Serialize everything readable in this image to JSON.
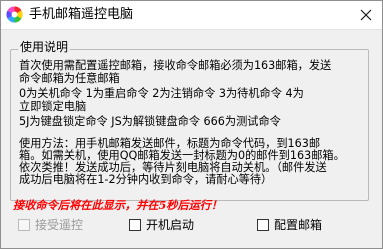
{
  "window": {
    "title": "手机邮箱遥控电脑"
  },
  "instructions": {
    "group_title": "使用说明",
    "lines": [
      "首次使用需配置遥控邮箱，接收命令邮箱必须为163邮箱，发送",
      "命令邮箱为任意邮箱",
      "0为关机命令   1为重启命令   2为注销命令   3为待机命令   4为",
      "立即锁定电脑",
      "5J为键盘锁定命令   JS为解锁键盘命令   666为测试命令",
      "",
      "使用方法：用手机邮箱发送邮件，标题为命令代码，到163邮",
      "箱。如需关机，使用QQ邮箱发送一封标题为0的邮件到163邮箱。",
      "依次类推！发送成功后，等待片刻电脑将自动关机。（邮件发送",
      "成功后电脑将在1-2分钟内收到命令，请耐心等待）"
    ]
  },
  "warning_text": "接收命令后将在此显示，并在5秒后运行！",
  "options": {
    "accept_remote": {
      "label": "接受遥控",
      "checked": false,
      "disabled": true
    },
    "startup": {
      "label": "开机启动",
      "checked": false,
      "disabled": false
    },
    "configure_mailbox": {
      "label": "配置邮箱",
      "checked": false,
      "disabled": false
    }
  },
  "colors": {
    "warning": "#ff0000",
    "window_bg": "#f0f0f0",
    "titlebar_bg": "#ffffff"
  }
}
